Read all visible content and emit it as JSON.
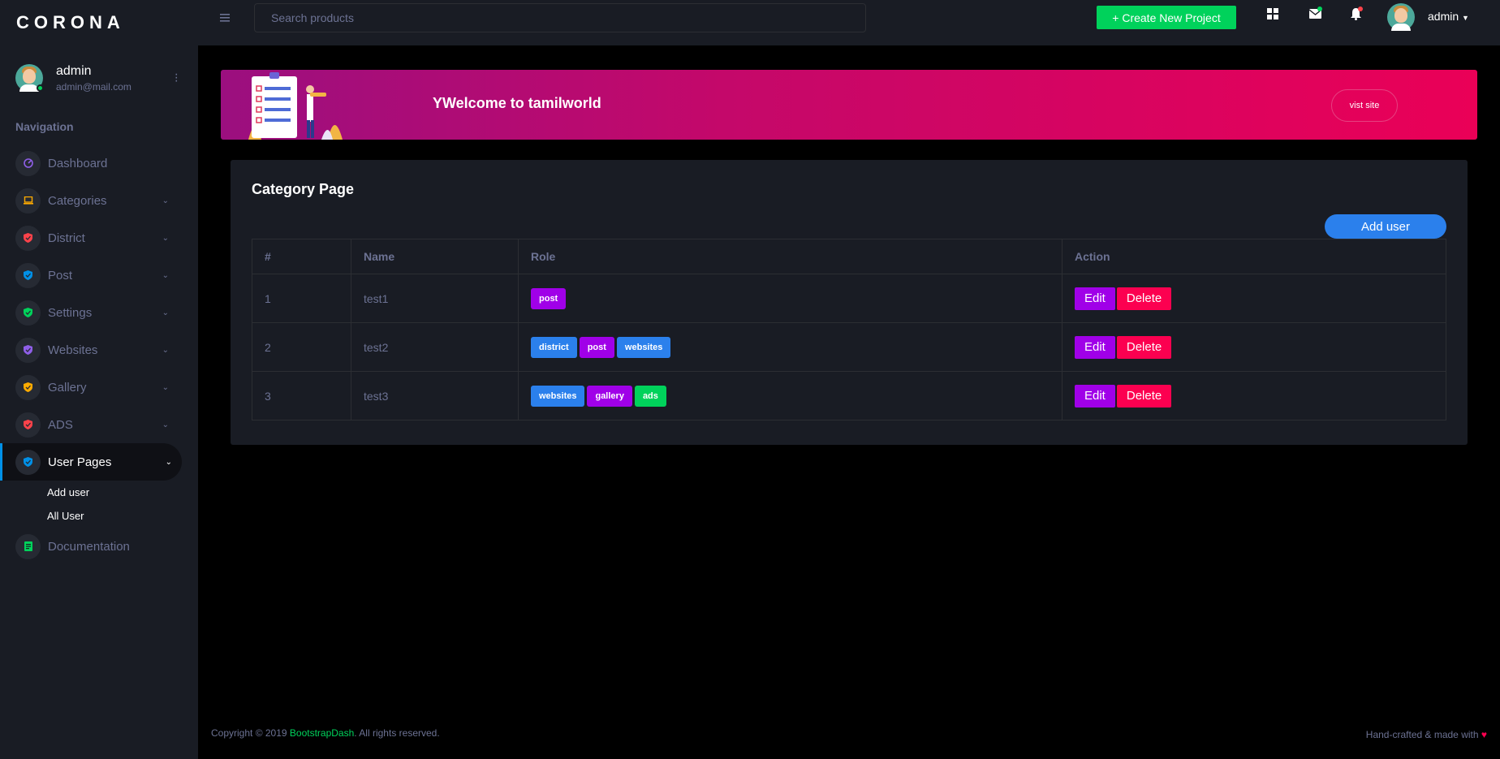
{
  "brand": "CORONA",
  "profile": {
    "name": "admin",
    "email": "admin@mail.com"
  },
  "sidebar": {
    "category": "Navigation",
    "items": [
      {
        "label": "Dashboard",
        "icon": "speedometer-icon",
        "color": "#8f5fe8"
      },
      {
        "label": "Categories",
        "icon": "laptop-icon",
        "color": "#ffab00"
      },
      {
        "label": "District",
        "icon": "shield-icon",
        "color": "#fc424a"
      },
      {
        "label": "Post",
        "icon": "shield-icon",
        "color": "#0090e7"
      },
      {
        "label": "Settings",
        "icon": "shield-icon",
        "color": "#00d25b"
      },
      {
        "label": "Websites",
        "icon": "shield-icon",
        "color": "#8f5fe8"
      },
      {
        "label": "Gallery",
        "icon": "shield-icon",
        "color": "#ffab00"
      },
      {
        "label": "ADS",
        "icon": "shield-icon",
        "color": "#fc424a"
      },
      {
        "label": "User Pages",
        "icon": "shield-icon",
        "color": "#0090e7"
      }
    ],
    "sub_items": [
      "Add user",
      "All User"
    ],
    "documentation": "Documentation"
  },
  "topbar": {
    "search_placeholder": "Search products",
    "create_button": "+ Create New Project",
    "user": "admin"
  },
  "banner": {
    "title": "YWelcome to tamilworld",
    "button": "vist site"
  },
  "card": {
    "title": "Category Page",
    "add_button": "Add user",
    "columns": [
      "#",
      "Name",
      "Role",
      "Action"
    ],
    "rows": [
      {
        "id": "1",
        "name": "test1",
        "roles": [
          "post"
        ]
      },
      {
        "id": "2",
        "name": "test2",
        "roles": [
          "district",
          "post",
          "websites"
        ]
      },
      {
        "id": "3",
        "name": "test3",
        "roles": [
          "websites",
          "gallery",
          "ads"
        ]
      }
    ],
    "edit_label": "Edit",
    "delete_label": "Delete"
  },
  "footer": {
    "copyright_prefix": "Copyright © 2019 ",
    "copyright_brand": "BootstrapDash",
    "copyright_suffix": ". All rights reserved.",
    "right": "Hand-crafted & made with"
  }
}
